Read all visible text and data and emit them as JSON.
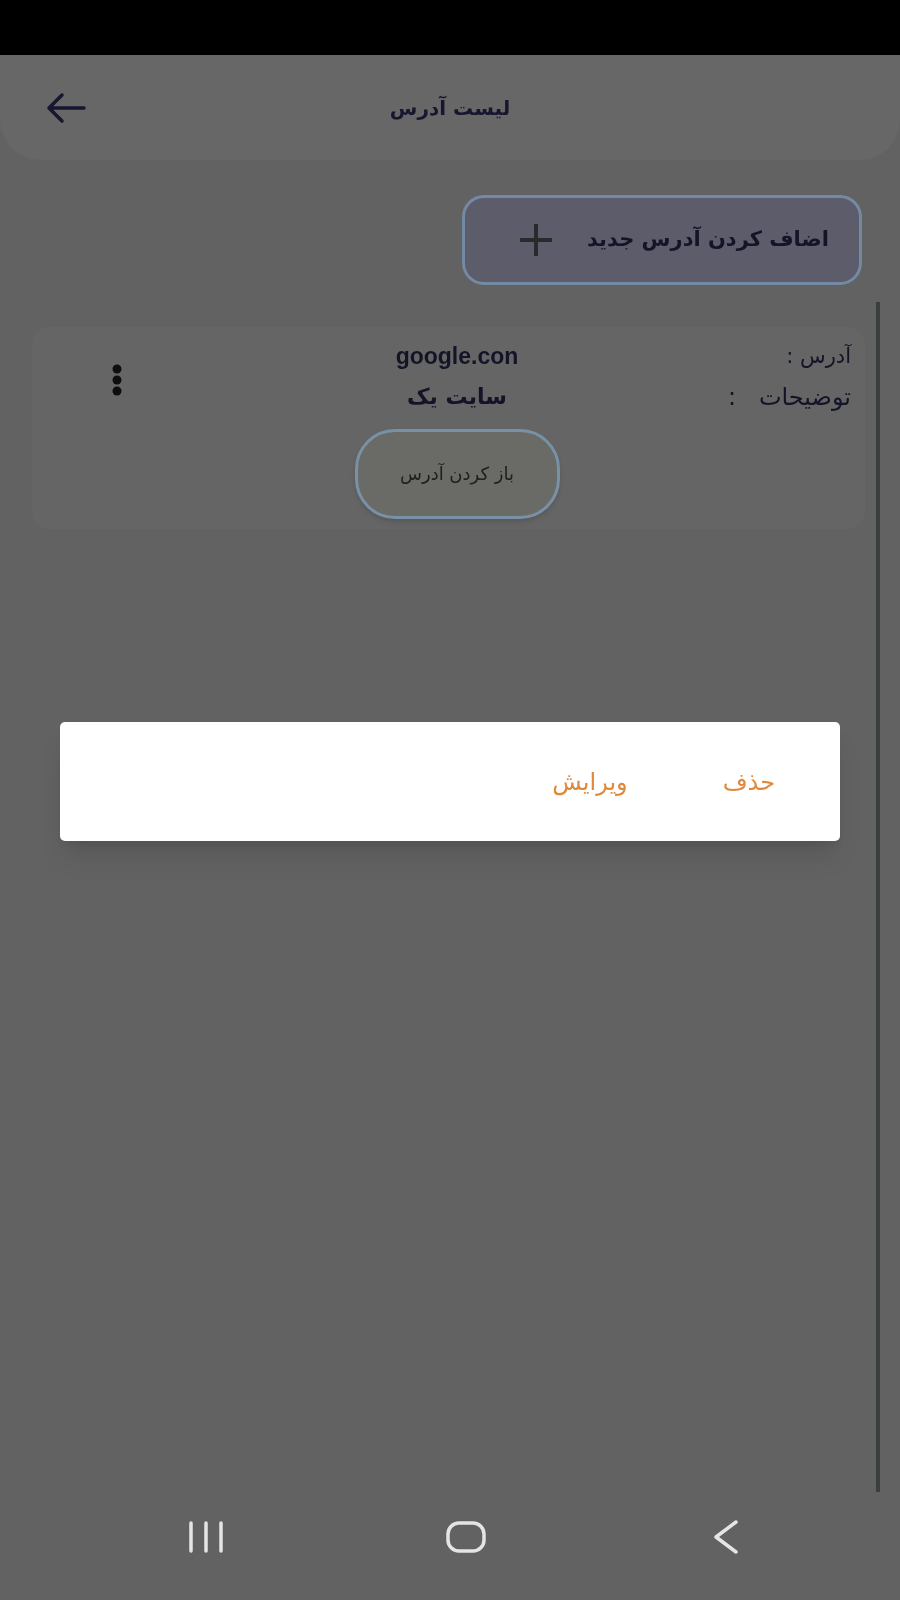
{
  "header": {
    "title": "لیست آدرس"
  },
  "add_button": {
    "label": "اضاف کردن آدرس جدید"
  },
  "addresses": [
    {
      "address_label": "آدرس :",
      "address": "google.con",
      "description_label": "توضیحات   :",
      "description": "سایت یک",
      "open_button": "باز کردن آدرس"
    }
  ],
  "menu": {
    "items": [
      "حذف",
      "ویرایش"
    ]
  }
}
